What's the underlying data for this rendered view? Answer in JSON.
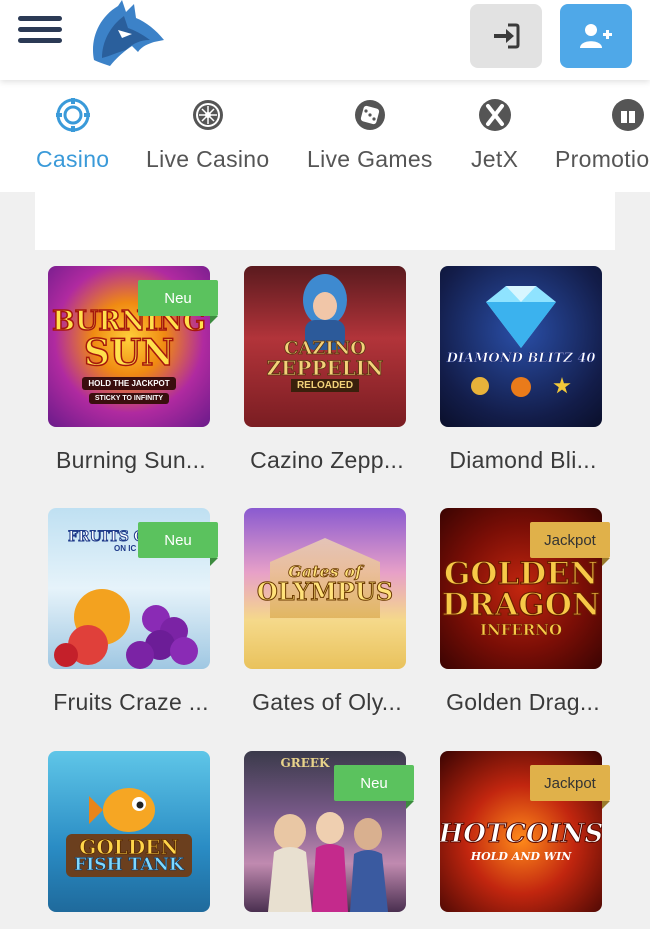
{
  "header": {
    "logo_icon": "wolf-logo-icon",
    "login_icon": "sign-in-icon",
    "register_icon": "user-plus-icon"
  },
  "nav": {
    "tabs": [
      {
        "label": "Casino",
        "icon": "casino-chip-icon",
        "active": true
      },
      {
        "label": "Live Casino",
        "icon": "roulette-icon",
        "active": false
      },
      {
        "label": "Live Games",
        "icon": "dice-icon",
        "active": false
      },
      {
        "label": "JetX",
        "icon": "jetx-icon",
        "active": false
      },
      {
        "label": "Promotions",
        "icon": "gift-icon",
        "active": false
      }
    ]
  },
  "games": [
    {
      "title": "Burning Sun...",
      "badge": "Neu",
      "art_line1": "BURNING",
      "art_line2": "SUN",
      "art_line3": "HOLD THE JACKPOT",
      "art_line4": "STICKY TO INFINITY"
    },
    {
      "title": "Cazino Zepp...",
      "badge": "",
      "art_line1": "CAZINO",
      "art_line2": "ZEPPELIN",
      "art_line3": "RELOADED"
    },
    {
      "title": "Diamond Bli...",
      "badge": "",
      "art_line1": "DIAMOND BLITZ 40"
    },
    {
      "title": "Fruits Craze ...",
      "badge": "Neu",
      "art_line1": "FRUITS C",
      "art_line2": "ON IC"
    },
    {
      "title": "Gates of Oly...",
      "badge": "",
      "art_line1": "Gates of",
      "art_line2": "OLYMPUS"
    },
    {
      "title": "Golden Drag...",
      "badge": "Jackpot",
      "art_line1": "GOLDEN",
      "art_line2": "DRAGON",
      "art_line3": "INFERNO"
    },
    {
      "title": "",
      "badge": "",
      "art_line1": "GOLDEN",
      "art_line2": "FISH TANK"
    },
    {
      "title": "",
      "badge": "Neu",
      "art_line1": "GREEK"
    },
    {
      "title": "",
      "badge": "Jackpot",
      "art_line1": "HOT",
      "art_line2": "COINS",
      "art_line3": "HOLD AND WIN"
    }
  ],
  "colors": {
    "accent": "#3a9ad9",
    "neu": "#5bc25e",
    "jackpot": "#e0b14a",
    "register": "#4fa8e8"
  }
}
